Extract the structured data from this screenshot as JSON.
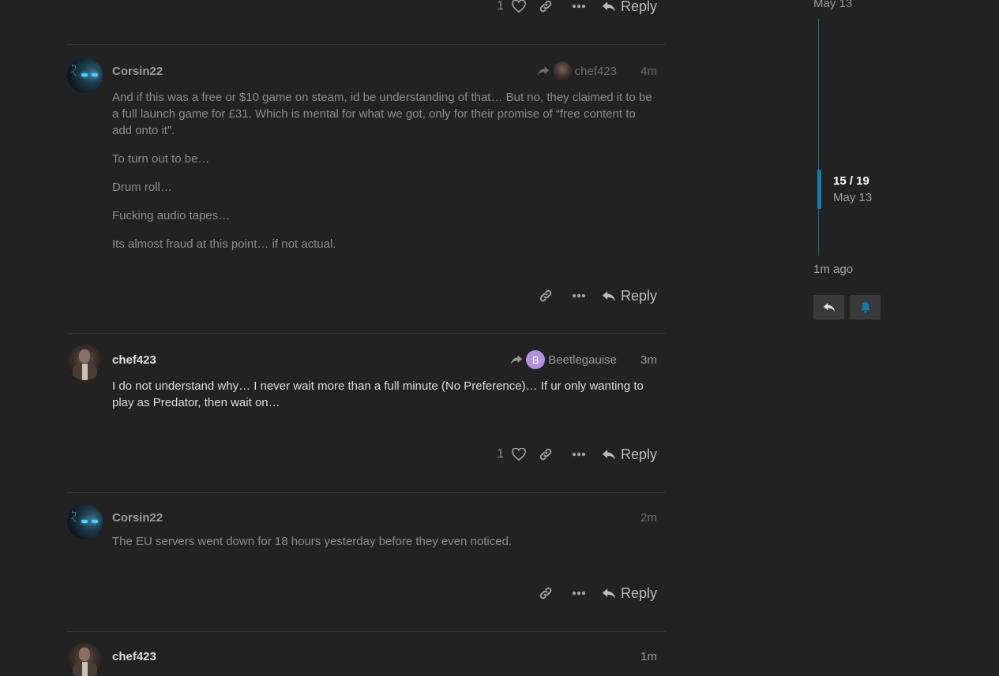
{
  "posts": [
    {
      "id": "top",
      "like_count": "1",
      "reply_label": "Reply"
    },
    {
      "id": "p1",
      "username": "Corsin22",
      "reply_to_name": "chef423",
      "age": "4m",
      "paragraphs": [
        "And if this was a free or $10 game on steam, id be understanding of that… But no, they claimed it to be a full launch game for £31. Which is mental for what we got, only for their promise of “free content to add onto it”.",
        "To turn out to be…",
        "Drum roll…",
        "Fucking audio tapes…",
        "Its almost fraud at this point… if not actual."
      ],
      "reply_label": "Reply",
      "avatar_glyphs": "ㄅㄟ"
    },
    {
      "id": "p2",
      "username": "chef423",
      "reply_to_letter": "B",
      "reply_to_name": "Beetlegauise",
      "age": "3m",
      "paragraphs": [
        "I do not understand why… I never wait more than a full minute (No Preference)… If ur only wanting to play as Predator, then wait on…"
      ],
      "like_count": "1",
      "reply_label": "Reply"
    },
    {
      "id": "p3",
      "username": "Corsin22",
      "age": "2m",
      "paragraphs": [
        "The EU servers went down for 18 hours yesterday before they even noticed."
      ],
      "reply_label": "Reply",
      "avatar_glyphs": "ㄅㄟ"
    },
    {
      "id": "p4",
      "username": "chef423",
      "age": "1m"
    }
  ],
  "timeline": {
    "top_date": "May 13",
    "position": "15 / 19",
    "current_date": "May 13",
    "bottom_label": "1m ago",
    "progress_fraction": 0.7895
  },
  "colors": {
    "background": "#222222",
    "accent": "#0e7fad",
    "letter_avatar": "#b28fe0"
  },
  "icons": [
    "heart-icon",
    "link-icon",
    "ellipsis-icon",
    "reply-icon",
    "share-arrow-icon",
    "bell-icon"
  ]
}
